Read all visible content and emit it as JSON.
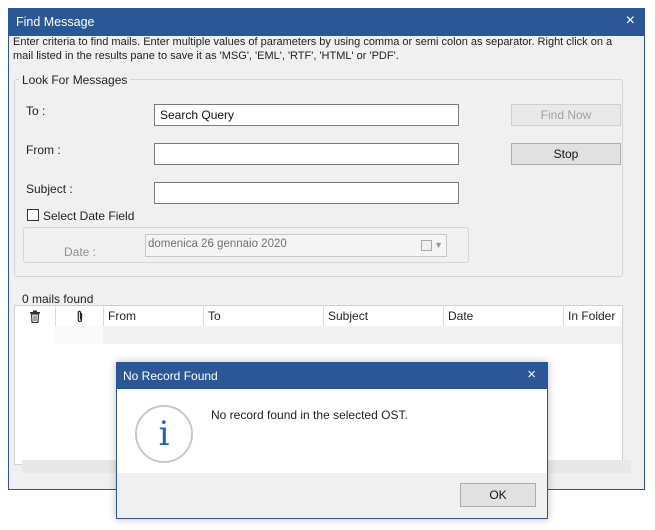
{
  "window": {
    "title": "Find Message",
    "close_glyph": "×",
    "instructions": "Enter criteria to find mails. Enter multiple values of parameters by using comma or semi colon as separator. Right click on a mail listed in the results pane to save it as 'MSG', 'EML', 'RTF', 'HTML' or 'PDF'.",
    "accent": "#2b5797"
  },
  "search": {
    "group_title": "Look For Messages",
    "to_label": "To :",
    "to_value": "Search Query",
    "from_label": "From :",
    "from_value": "",
    "subject_label": "Subject :",
    "subject_value": "",
    "select_date_label": "Select Date Field",
    "select_date_checked": false,
    "date_label": "Date :",
    "date_value": "domenica 26  gennaio  2020",
    "find_now_label": "Find Now",
    "stop_label": "Stop"
  },
  "results": {
    "count_text": "0 mails found",
    "columns": [
      "",
      "",
      "From",
      "To",
      "Subject",
      "Date",
      "In Folder"
    ],
    "icons": [
      "trash-icon",
      "paperclip-icon"
    ],
    "rows": []
  },
  "dialog": {
    "title": "No Record Found",
    "close_glyph": "×",
    "message": "No record found in the selected OST.",
    "icon": "info-icon",
    "ok_label": "OK"
  }
}
